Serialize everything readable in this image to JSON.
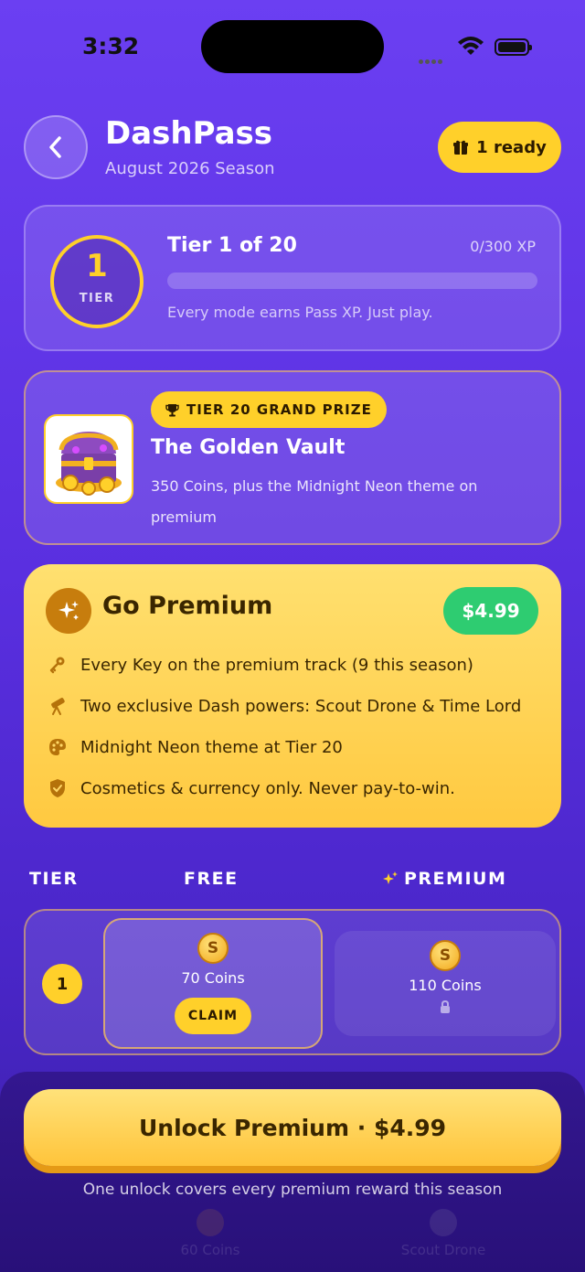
{
  "status": {
    "time": "3:32"
  },
  "header": {
    "title": "DashPass",
    "subtitle": "August 2026 Season",
    "ready_label": "1 ready"
  },
  "tier_progress": {
    "tier_number": "1",
    "tier_word": "TIER",
    "label": "Tier 1 of 20",
    "xp_text": "0/300 XP",
    "xp_fraction": 0,
    "hint": "Every mode earns Pass XP. Just play."
  },
  "grand_prize": {
    "badge": "TIER 20 GRAND PRIZE",
    "title": "The Golden Vault",
    "description": "350 Coins, plus the Midnight Neon theme on premium"
  },
  "premium": {
    "title": "Go Premium",
    "price": "$4.99",
    "features": [
      {
        "icon": "key-icon",
        "text": "Every Key on the premium track (9 this season)"
      },
      {
        "icon": "telescope-icon",
        "text": "Two exclusive Dash powers: Scout Drone & Time Lord"
      },
      {
        "icon": "palette-icon",
        "text": "Midnight Neon theme at Tier 20"
      },
      {
        "icon": "shield-check-icon",
        "text": "Cosmetics & currency only. Never pay-to-win."
      }
    ]
  },
  "track": {
    "headers": {
      "tier": "TIER",
      "free": "FREE",
      "premium": "PREMIUM"
    },
    "rows": [
      {
        "tier": "1",
        "free": {
          "coin_symbol": "S",
          "label": "70 Coins",
          "action": "CLAIM"
        },
        "premium": {
          "coin_symbol": "S",
          "label": "110 Coins"
        }
      }
    ],
    "partial_next_row": {
      "free_label": "60 Coins",
      "premium_label": "Scout Drone"
    }
  },
  "footer": {
    "unlock_label": "Unlock Premium · $4.99",
    "note": "One unlock covers every premium reward this season"
  },
  "colors": {
    "accent": "#ffd02a",
    "background": "#5a2fe0",
    "success": "#2ecc71"
  }
}
